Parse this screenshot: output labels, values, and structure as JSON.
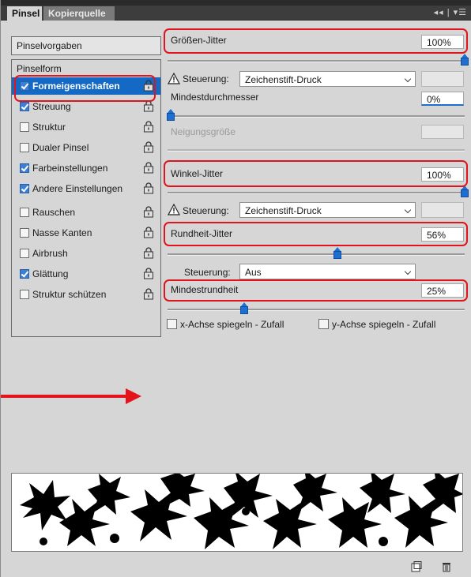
{
  "tabs": [
    {
      "label": "Pinsel",
      "active": true
    },
    {
      "label": "Kopierquelle",
      "active": false
    }
  ],
  "panel_menu": "◂◂ | ▾☰",
  "left": {
    "preset_button": "Pinselvorgaben",
    "section_header": "Pinselform",
    "options": [
      {
        "label": "Formeigenschaften",
        "checked": true,
        "selected": true
      },
      {
        "label": "Streuung",
        "checked": true
      },
      {
        "label": "Struktur",
        "checked": false
      },
      {
        "label": "Dualer Pinsel",
        "checked": false
      },
      {
        "label": "Farbeinstellungen",
        "checked": true
      },
      {
        "label": "Andere Einstellungen",
        "checked": true
      },
      {
        "label": "Rauschen",
        "checked": false
      },
      {
        "label": "Nasse Kanten",
        "checked": false
      },
      {
        "label": "Airbrush",
        "checked": false
      },
      {
        "label": "Glättung",
        "checked": true
      },
      {
        "label": "Struktur schützen",
        "checked": false
      }
    ]
  },
  "right": {
    "size_jitter": {
      "label": "Größen-Jitter",
      "value": "100%",
      "slider_percent": 100
    },
    "control1": {
      "label": "Steuerung:",
      "value": "Zeichenstift-Druck"
    },
    "min_diameter": {
      "label": "Mindestdurchmesser",
      "value": "0%",
      "slider_percent": 0
    },
    "tilt_scale": {
      "label": "Neigungsgröße"
    },
    "angle_jitter": {
      "label": "Winkel-Jitter",
      "value": "100%",
      "slider_percent": 100
    },
    "control2": {
      "label": "Steuerung:",
      "value": "Zeichenstift-Druck"
    },
    "roundness_jitter": {
      "label": "Rundheit-Jitter",
      "value": "56%",
      "slider_percent": 56
    },
    "control3": {
      "label": "Steuerung:",
      "value": "Aus"
    },
    "min_roundness": {
      "label": "Mindestrundheit",
      "value": "25%",
      "slider_percent": 25
    },
    "flip_x": {
      "label": "x-Achse spiegeln - Zufall",
      "checked": false
    },
    "flip_y": {
      "label": "y-Achse spiegeln - Zufall",
      "checked": false
    }
  },
  "colors": {
    "highlight": "#e0141c",
    "selection": "#1469c4",
    "slider_handle": "#1e6fcf",
    "panel_bg": "#d6d6d6"
  },
  "icons": [
    "lock-icon",
    "warning-icon",
    "chevron-down-icon",
    "new-preset-icon",
    "trash-icon",
    "panel-menu-icon"
  ]
}
